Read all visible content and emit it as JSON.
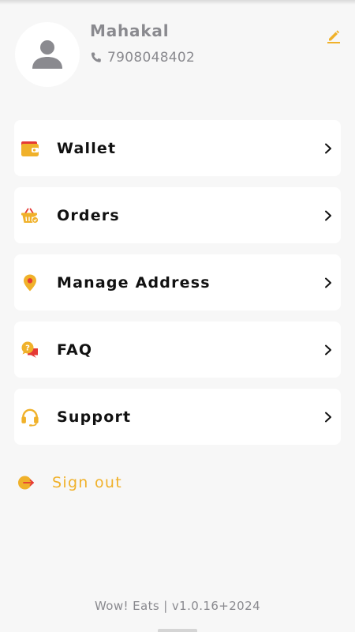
{
  "profile": {
    "name": "Mahakal",
    "phone": "7908048402",
    "avatar_icon": "person-icon",
    "edit_icon": "edit-pencil-icon"
  },
  "menu": {
    "items": [
      {
        "label": "Wallet",
        "icon": "wallet-icon"
      },
      {
        "label": "Orders",
        "icon": "basket-icon"
      },
      {
        "label": "Manage Address",
        "icon": "location-pin-icon"
      },
      {
        "label": "FAQ",
        "icon": "faq-chat-icon"
      },
      {
        "label": "Support",
        "icon": "headset-icon"
      }
    ],
    "chevron_icon": "chevron-right-icon"
  },
  "signout": {
    "label": "Sign out",
    "icon": "signout-icon"
  },
  "footer": {
    "version_text": "Wow! Eats | v1.0.16+2024"
  },
  "colors": {
    "accent": "#f0b12a",
    "accent_dark": "#e8a71a",
    "red": "#e53935",
    "muted_text": "#8a8a8f",
    "background": "#f7f7f7",
    "card": "#ffffff"
  }
}
